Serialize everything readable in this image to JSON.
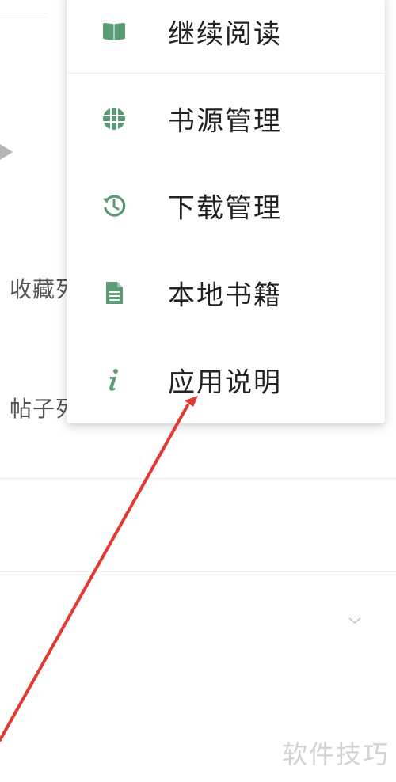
{
  "background": {
    "row1_label": "收藏列",
    "row2_label": "帖子列"
  },
  "menu": {
    "items": [
      {
        "label": "继续阅读",
        "icon": "book-open-icon"
      },
      {
        "label": "书源管理",
        "icon": "globe-icon"
      },
      {
        "label": "下载管理",
        "icon": "history-icon"
      },
      {
        "label": "本地书籍",
        "icon": "document-icon"
      },
      {
        "label": "应用说明",
        "icon": "info-icon"
      }
    ]
  },
  "colors": {
    "icon_green": "#5a9b76",
    "annotation_red": "#e03a32"
  },
  "watermark": "软件技巧"
}
